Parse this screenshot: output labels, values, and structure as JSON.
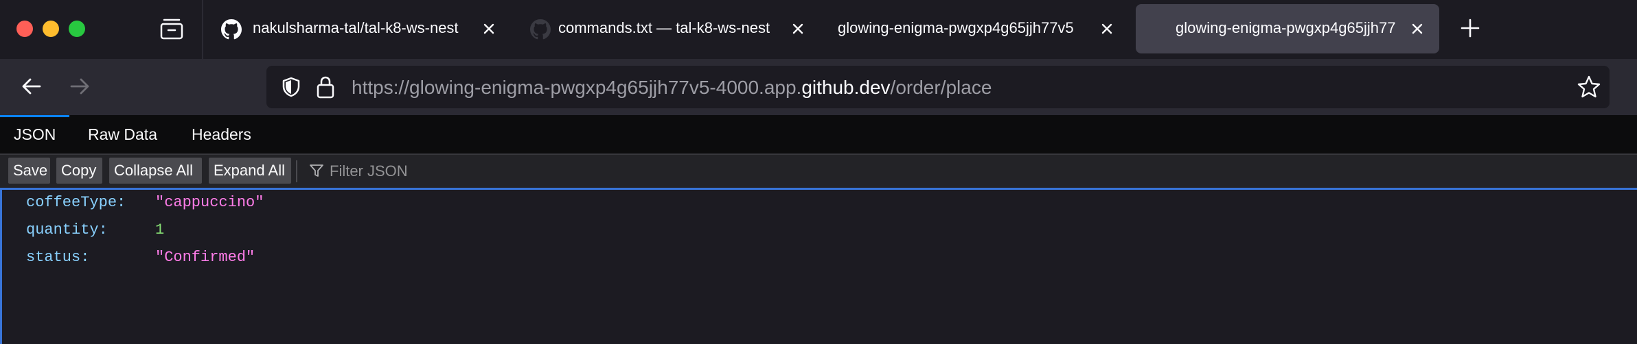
{
  "browser": {
    "tabs": [
      {
        "title": "nakulsharma-tal/tal-k8-ws-nest",
        "favicon": "github-icon",
        "active": false
      },
      {
        "title": "commands.txt — tal-k8-ws-nest",
        "favicon": "github-icon",
        "active": false
      },
      {
        "title": "glowing-enigma-pwgxp4g65jjh77v5",
        "favicon": "",
        "active": false
      },
      {
        "title": "glowing-enigma-pwgxp4g65jjh77",
        "favicon": "",
        "active": true
      }
    ],
    "url": {
      "prefix": "https://glowing-enigma-pwgxp4g65jjh77v5-4000.app.",
      "host": "github.dev",
      "path": "/order/place"
    }
  },
  "viewer": {
    "tabs": [
      "JSON",
      "Raw Data",
      "Headers"
    ],
    "selected_tab": "JSON",
    "toolbar": {
      "save": "Save",
      "copy": "Copy",
      "collapse_all": "Collapse All",
      "expand_all": "Expand All",
      "filter_placeholder": "Filter JSON"
    },
    "rows": [
      {
        "key": "coffeeType:",
        "value": "\"cappuccino\"",
        "type": "string"
      },
      {
        "key": "quantity:",
        "value": "1",
        "type": "number"
      },
      {
        "key": "status:",
        "value": "\"Confirmed\"",
        "type": "string"
      }
    ]
  },
  "colors": {
    "accent": "#0a84ff",
    "string": "#ff7de9",
    "number": "#86de74",
    "key": "#89d1ff"
  }
}
